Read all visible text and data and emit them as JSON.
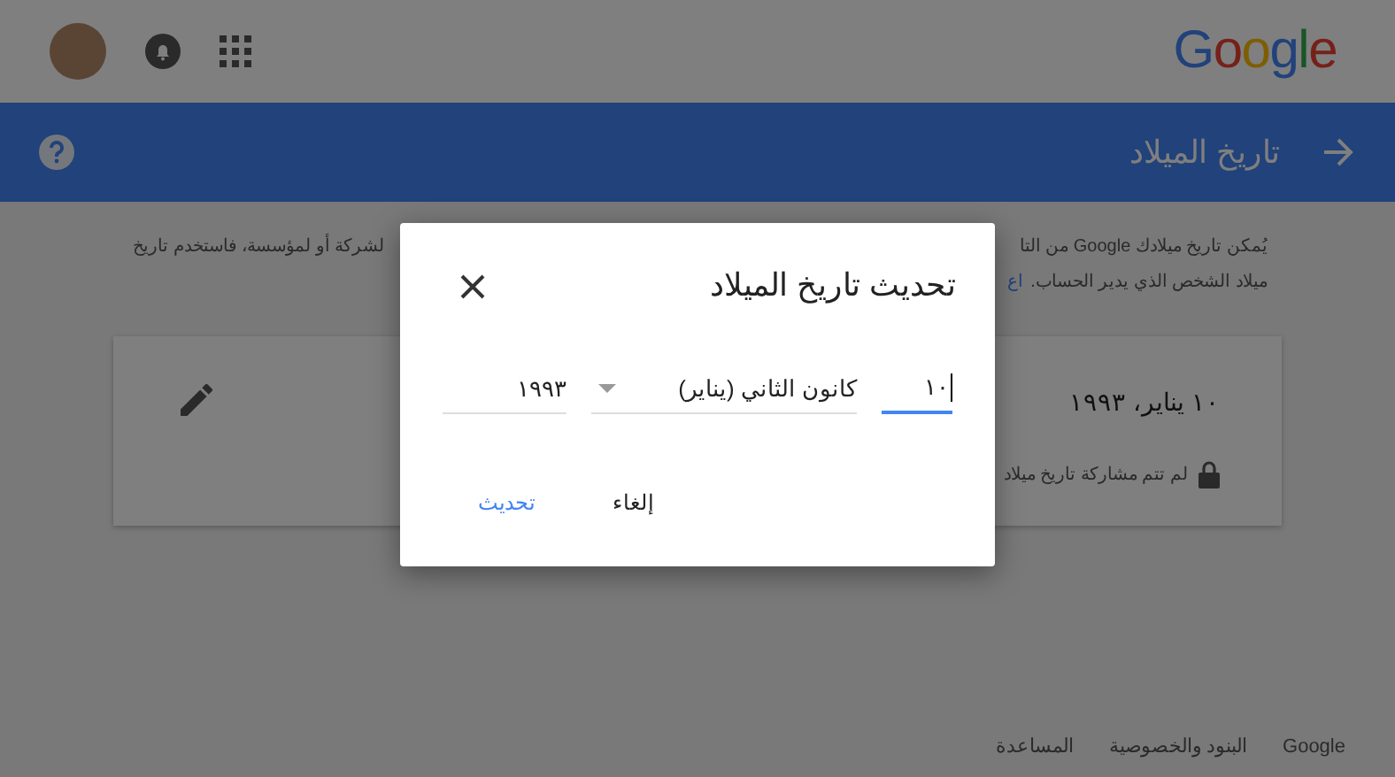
{
  "header": {
    "logo": "Google"
  },
  "title_bar": {
    "title": "تاريخ الميلاد"
  },
  "intro_lines": [
    {
      "right": "يُمكن تاريخ ميلادك Google من التا",
      "left": "لشركة أو لمؤسسة، فاستخدم تاريخ"
    },
    {
      "right": "ميلاد الشخص الذي يدير الحساب.",
      "link": "اع"
    }
  ],
  "card": {
    "date": "١٠ يناير، ١٩٩٣",
    "sharing_note": "لم تتم مشاركة تاريخ ميلاد"
  },
  "dialog": {
    "title": "تحديث تاريخ الميلاد",
    "fields": [
      {
        "kind": "text",
        "value": "١٠",
        "focused": true
      },
      {
        "kind": "select",
        "value": "كانون الثاني (يناير)",
        "focused": false
      },
      {
        "kind": "text",
        "value": "١٩٩٣",
        "focused": false
      }
    ],
    "buttons": [
      {
        "label": "إلغاء",
        "kind": "text"
      },
      {
        "label": "تحديث",
        "kind": "primary"
      }
    ]
  },
  "footer": [
    "Google",
    "البنود والخصوصية",
    "المساعدة"
  ]
}
